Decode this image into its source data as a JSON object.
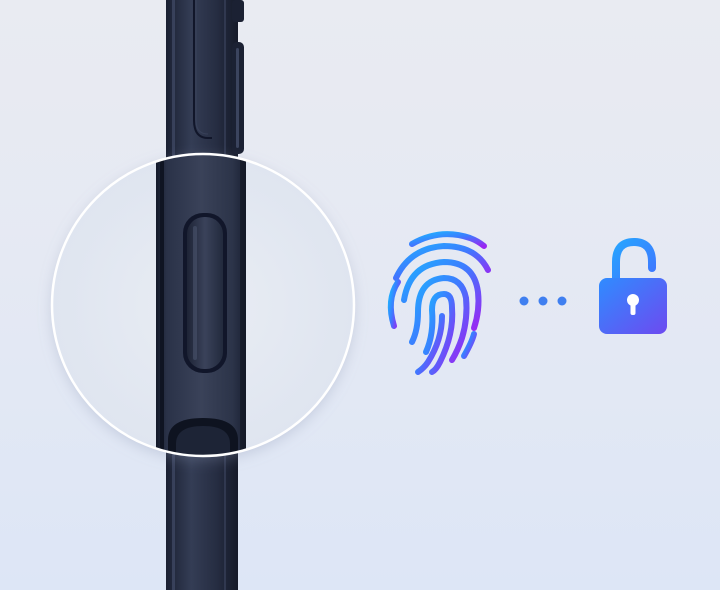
{
  "image": {
    "description_icons": [
      "fingerprint-icon",
      "ellipsis-dots-icon",
      "unlocked-padlock-icon"
    ],
    "colors": {
      "background_top": "#e9ebf2",
      "background_bottom": "#dde6f6",
      "phone_frame": "#2b3348",
      "phone_frame_dark": "#1c2235",
      "fingerprint_gradient_start": "#1fa2ff",
      "fingerprint_gradient_end": "#8b2cf5",
      "dots": "#3f7ff0",
      "lock_gradient_start": "#2e8bff",
      "lock_gradient_end": "#6b4cf0",
      "lens_border": "#ffffff"
    }
  }
}
